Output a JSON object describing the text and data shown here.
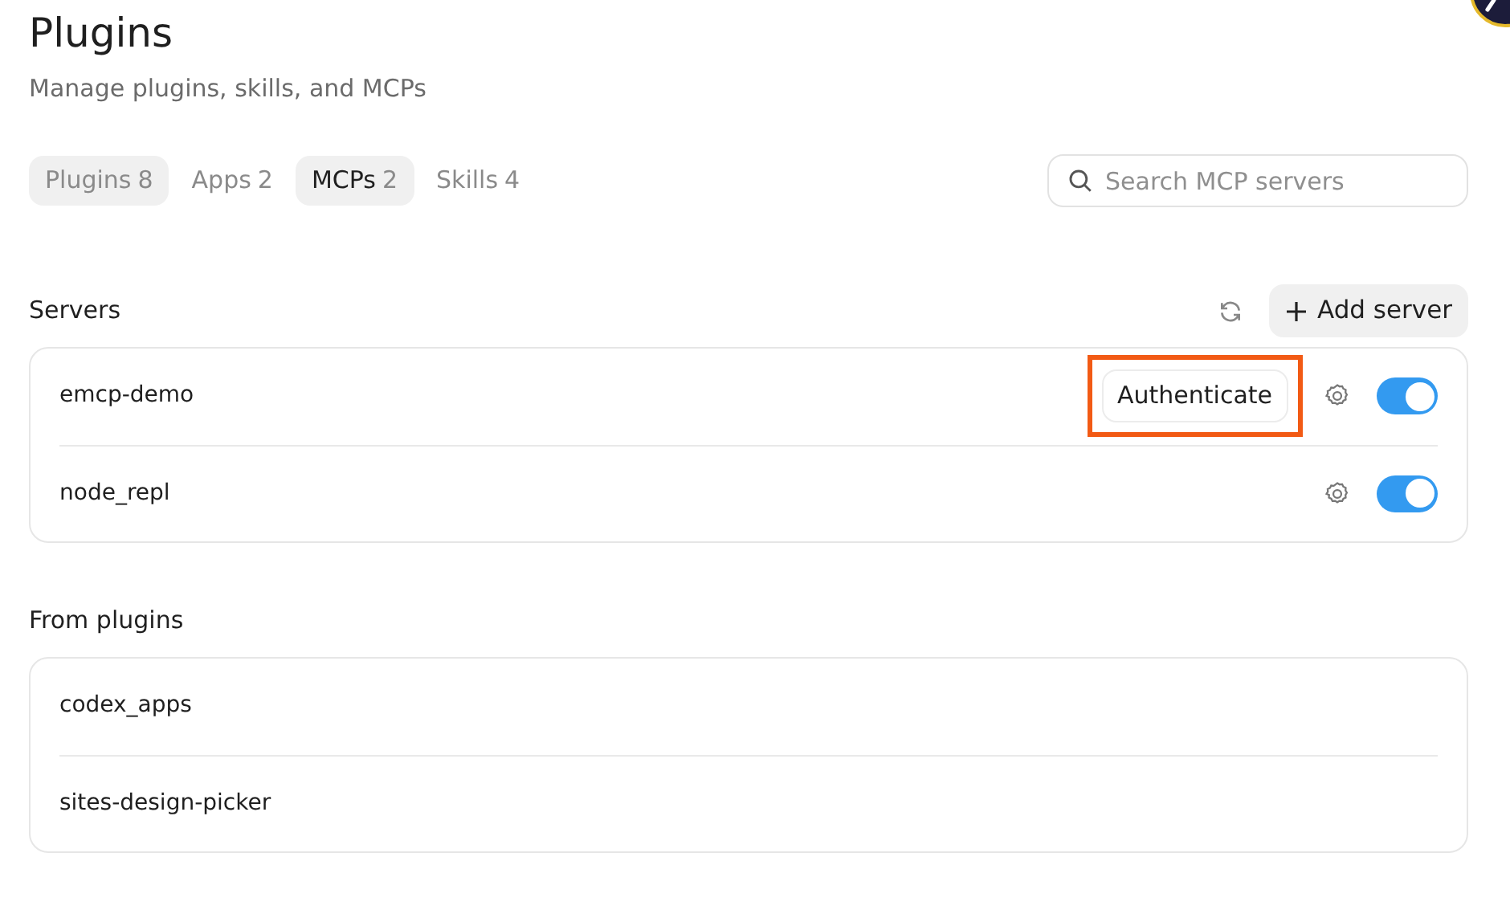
{
  "header": {
    "title": "Plugins",
    "subtitle": "Manage plugins, skills, and MCPs"
  },
  "tabs": [
    {
      "label": "Plugins",
      "count": "8",
      "selected": false,
      "shaded": true
    },
    {
      "label": "Apps",
      "count": "2",
      "selected": false,
      "shaded": false
    },
    {
      "label": "MCPs",
      "count": "2",
      "selected": true,
      "shaded": true
    },
    {
      "label": "Skills",
      "count": "4",
      "selected": false,
      "shaded": false
    }
  ],
  "search": {
    "placeholder": "Search MCP servers"
  },
  "servers": {
    "heading": "Servers",
    "add_button": "Add server",
    "items": [
      {
        "name": "emcp-demo",
        "action": "Authenticate",
        "highlighted": true,
        "on": true
      },
      {
        "name": "node_repl",
        "on": true
      }
    ]
  },
  "from_plugins": {
    "heading": "From plugins",
    "items": [
      {
        "name": "codex_apps"
      },
      {
        "name": "sites-design-picker"
      }
    ]
  }
}
